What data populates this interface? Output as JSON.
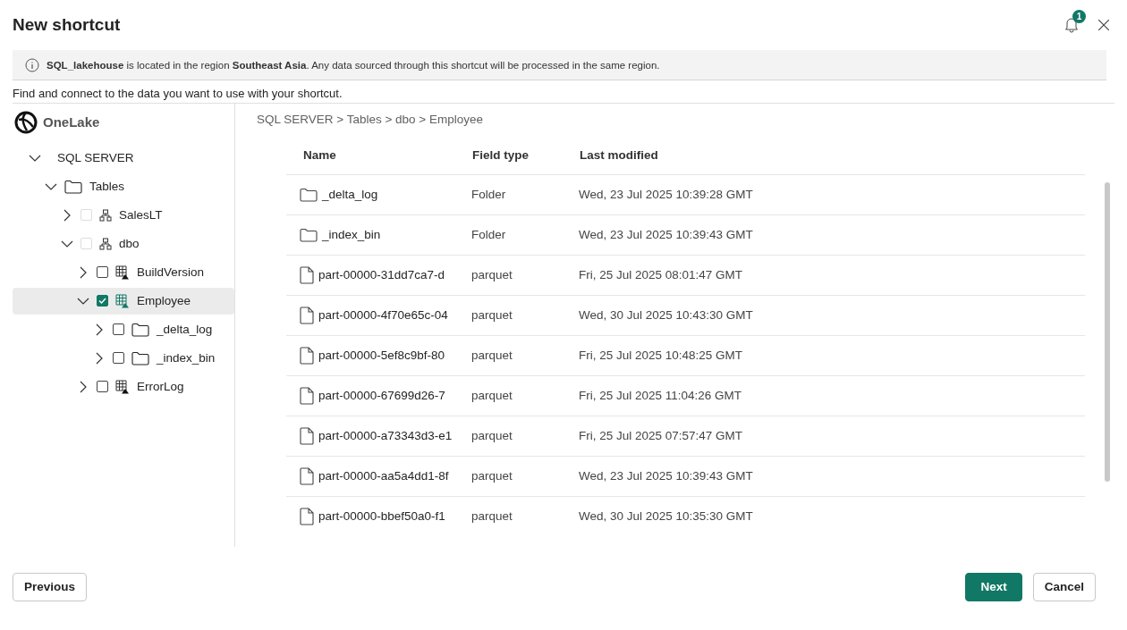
{
  "dialog": {
    "title": "New shortcut",
    "notifications": {
      "count": "1"
    }
  },
  "banner": {
    "text": "**SQL_lakehouse** is located in the region **Southeast Asia**. Any data sourced through this shortcut will be processed in the same region."
  },
  "instruction": "Find and connect to the data you want to use with your shortcut.",
  "sidebar": {
    "brand": "OneLake",
    "tree": [
      {
        "label": "SQL SERVER",
        "kind": "server",
        "expanded": true,
        "children": [
          {
            "label": "Tables",
            "kind": "folder",
            "expanded": true,
            "children": [
              {
                "label": "SalesLT",
                "kind": "schema",
                "expanded": false,
                "checked": false,
                "disabled": true,
                "selected": false
              },
              {
                "label": "dbo",
                "kind": "schema",
                "expanded": true,
                "checked": false,
                "disabled": true,
                "selected": false,
                "children": [
                  {
                    "label": "BuildVersion",
                    "kind": "table",
                    "expanded": false,
                    "checked": false,
                    "disabled": false,
                    "selected": false
                  },
                  {
                    "label": "Employee",
                    "kind": "table",
                    "expanded": true,
                    "checked": true,
                    "disabled": false,
                    "selected": true,
                    "children": [
                      {
                        "label": "_delta_log",
                        "kind": "subfolder",
                        "expanded": false,
                        "checked": false,
                        "disabled": false,
                        "selected": false
                      },
                      {
                        "label": "_index_bin",
                        "kind": "subfolder",
                        "expanded": false,
                        "checked": false,
                        "disabled": false,
                        "selected": false
                      }
                    ]
                  },
                  {
                    "label": "ErrorLog",
                    "kind": "table",
                    "expanded": false,
                    "checked": false,
                    "disabled": false,
                    "selected": false
                  }
                ]
              }
            ]
          }
        ]
      }
    ]
  },
  "breadcrumb": "SQL SERVER > Tables > dbo > Employee",
  "table": {
    "columns": [
      "Name",
      "Field type",
      "Last modified"
    ],
    "rows": [
      {
        "kind": "folder",
        "name": "_delta_log",
        "type": "Folder",
        "modified": "Wed, 23 Jul 2025 10:39:28 GMT"
      },
      {
        "kind": "folder",
        "name": "_index_bin",
        "type": "Folder",
        "modified": "Wed, 23 Jul 2025 10:39:43 GMT"
      },
      {
        "kind": "file",
        "name": "part-00000-31dd7ca7-d",
        "type": "parquet",
        "modified": "Fri, 25 Jul 2025 08:01:47 GMT"
      },
      {
        "kind": "file",
        "name": "part-00000-4f70e65c-04",
        "type": "parquet",
        "modified": "Wed, 30 Jul 2025 10:43:30 GMT"
      },
      {
        "kind": "file",
        "name": "part-00000-5ef8c9bf-80",
        "type": "parquet",
        "modified": "Fri, 25 Jul 2025 10:48:25 GMT"
      },
      {
        "kind": "file",
        "name": "part-00000-67699d26-7",
        "type": "parquet",
        "modified": "Fri, 25 Jul 2025 11:04:26 GMT"
      },
      {
        "kind": "file",
        "name": "part-00000-a73343d3-e1",
        "type": "parquet",
        "modified": "Fri, 25 Jul 2025 07:57:47 GMT"
      },
      {
        "kind": "file",
        "name": "part-00000-aa5a4dd1-8f",
        "type": "parquet",
        "modified": "Wed, 23 Jul 2025 10:39:43 GMT"
      },
      {
        "kind": "file",
        "name": "part-00000-bbef50a0-f1",
        "type": "parquet",
        "modified": "Wed, 30 Jul 2025 10:35:30 GMT"
      }
    ]
  },
  "footer": {
    "buttons": [
      {
        "label": "Previous",
        "kind": "secondary"
      },
      {
        "label": "Next",
        "kind": "primary"
      },
      {
        "label": "Cancel",
        "kind": "secondary"
      }
    ]
  }
}
